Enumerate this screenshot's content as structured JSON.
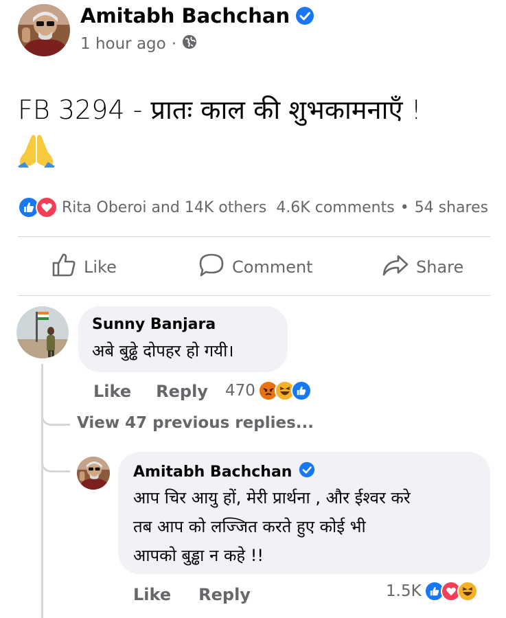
{
  "post": {
    "author": "Amitabh Bachchan",
    "time": "1 hour ago",
    "separator": "·",
    "text": "FB 3294 - प्रातः काल की शुभकामनाएँ  !",
    "reactions_text": "Rita Oberoi and 14K others",
    "comments_count": "4.6K comments",
    "dot": "•",
    "shares_count": "54 shares"
  },
  "actions": {
    "like": "Like",
    "comment": "Comment",
    "share": "Share"
  },
  "comment": {
    "author": "Sunny Banjara",
    "text": "अबे बुढ्ढे  दोपहर हो गयी।",
    "like": "Like",
    "reply": "Reply",
    "reaction_count": "470"
  },
  "view_previous": "View 47 previous replies...",
  "reply": {
    "author": "Amitabh Bachchan",
    "line1": "आप  चिर आयु हों, मेरी प्रार्थना  , और ईश्वर करे",
    "line2": "तब आप को लज्जित करते हुए कोई भी",
    "line3": "आपको बुड्ढा न कहे  !!",
    "like": "Like",
    "reply": "Reply",
    "reaction_count": "1.5K"
  },
  "colors": {
    "facebook_blue": "#1877f2",
    "love_red": "#f33e58",
    "angry_orange": "#e9710f",
    "haha_yellow": "#f7b125",
    "secondary_text": "#65676b",
    "bubble_bg": "#f0f2f5"
  }
}
